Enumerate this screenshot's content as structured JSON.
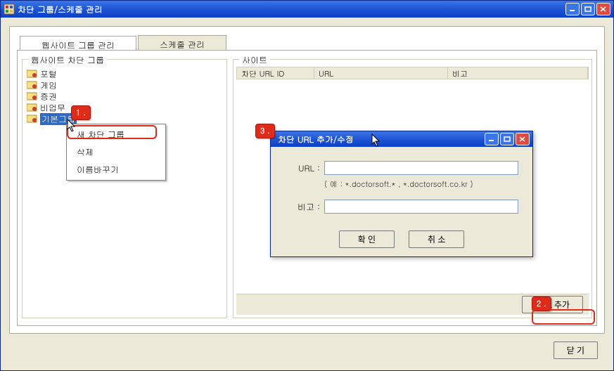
{
  "main_window": {
    "title": "차단 그룹/스케줄 관리"
  },
  "tabs": {
    "website_group": "웹사이트 그룹 관리",
    "schedule": "스케줄 관리"
  },
  "left_group": {
    "caption": "웹사이트 차단 그룹",
    "items": [
      "포털",
      "게임",
      "증권",
      "비업무",
      "기본그룹"
    ]
  },
  "right_group": {
    "caption": "사이트",
    "columns": [
      "차단 URL ID",
      "URL",
      "비고"
    ],
    "url_add_button": "URL 추가"
  },
  "context_menu": {
    "new_group": "새 차단 그룹",
    "delete": "삭제",
    "rename": "이름바꾸기"
  },
  "dialog": {
    "title": "차단 URL 추가/수정",
    "url_label": "URL :",
    "url_hint": "( 예 : *.doctorsoft.* , *.doctorsoft.co.kr )",
    "remark_label": "비고 :",
    "ok": "확 인",
    "cancel": "취 소"
  },
  "footer": {
    "close": "닫 기"
  },
  "annotations": {
    "a1": "1 .",
    "a2": "2 .",
    "a3": "3 ."
  }
}
